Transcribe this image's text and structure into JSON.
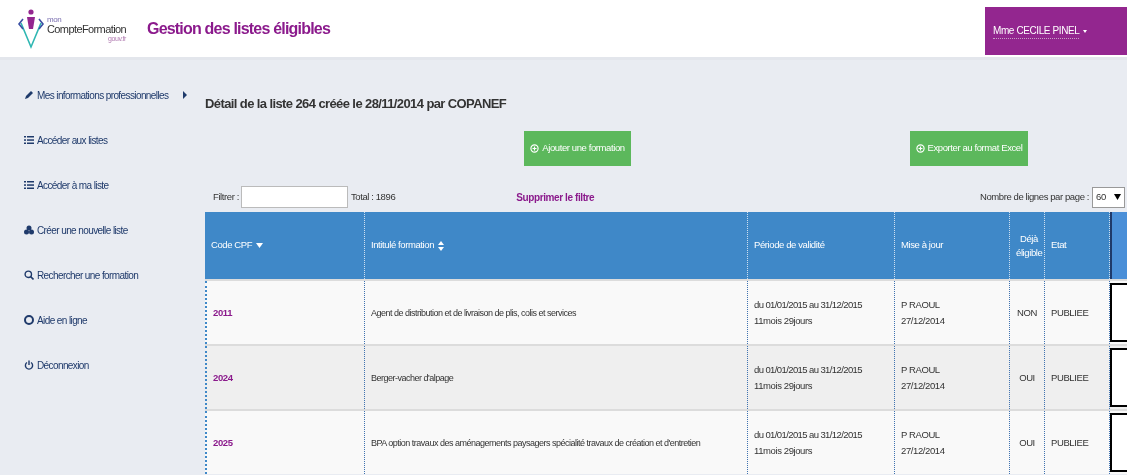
{
  "logo": {
    "small": "mon",
    "name": "CompteFormation",
    "domain": "gouv.fr"
  },
  "header": {
    "title": "Gestion des listes éligibles",
    "user": "Mme CECILE PINEL"
  },
  "sidebar": {
    "items": [
      {
        "kind": "pencil",
        "label": "Mes informations professionnelles",
        "submenu": true
      },
      {
        "kind": "list",
        "label": "Accéder aux listes",
        "submenu": false
      },
      {
        "kind": "list",
        "label": "Accéder à ma liste",
        "submenu": false
      },
      {
        "kind": "create",
        "label": "Créer une nouvelle liste",
        "submenu": false
      },
      {
        "kind": "search",
        "label": "Rechercher une formation",
        "submenu": false
      },
      {
        "kind": "help",
        "label": "Aide en ligne",
        "submenu": false
      },
      {
        "kind": "power",
        "label": "Déconnexion",
        "submenu": false
      }
    ]
  },
  "page_title": "Détail de la liste 264 créée le 28/11/2014 par COPANEF",
  "actions": [
    "Ajouter une formation",
    "Exporter au format Excel"
  ],
  "filter": {
    "label": "Filtrer :",
    "total": "Total : 1896",
    "clear": "Supprimer le filtre",
    "rows_label": "Nombre de lignes par page :",
    "rows_value": "60"
  },
  "table": {
    "columns": [
      {
        "label": "Code CPF",
        "kind": "sorted"
      },
      {
        "label": "Intitulé formation",
        "kind": "sortable"
      },
      {
        "label": "Période de validité",
        "kind": "plain"
      },
      {
        "label": "Mise à jour",
        "kind": "plain"
      },
      {
        "label": "Déjà éligible",
        "kind": "plain"
      },
      {
        "label": "Etat",
        "kind": "plain"
      }
    ],
    "rows": [
      {
        "code": "2011",
        "title": "Agent de distribution et de livraison de plis, colis et services",
        "period": "du 01/01/2015 au 31/12/2015",
        "duration": "11mois 29jours",
        "updated_by": "P RAOUL",
        "updated_on": "27/12/2014",
        "eligible": "NON",
        "state": "PUBLIEE"
      },
      {
        "code": "2024",
        "title": "Berger-vacher d'alpage",
        "period": "du 01/01/2015 au 31/12/2015",
        "duration": "11mois 29jours",
        "updated_by": "P RAOUL",
        "updated_on": "27/12/2014",
        "eligible": "OUI",
        "state": "PUBLIEE"
      },
      {
        "code": "2025",
        "title": "BPA option travaux des aménagements paysagers spécialité travaux de création et d'entretien",
        "period": "du 01/01/2015 au 31/12/2015",
        "duration": "11mois 29jours",
        "updated_by": "P RAOUL",
        "updated_on": "27/12/2014",
        "eligible": "OUI",
        "state": "PUBLIEE"
      }
    ]
  }
}
